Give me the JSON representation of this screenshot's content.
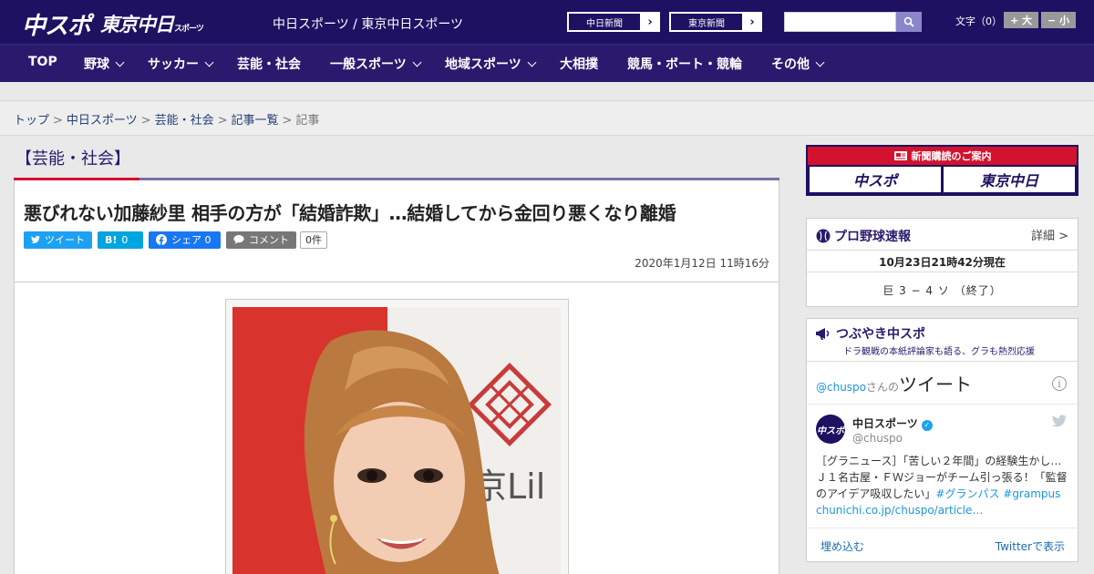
{
  "header": {
    "logo_chuspo": "中スポ",
    "logo_tokyo": "東京中日",
    "logo_tokyo_small": "スポーツ",
    "site_title": "中日スポーツ / 東京中日スポーツ",
    "paper_links": [
      "中日新聞",
      "東京新聞"
    ],
    "search_placeholder": "",
    "fontsize_label": "文字（0）",
    "fontsize_larger": "+ 大",
    "fontsize_smaller": "− 小"
  },
  "nav": {
    "items": [
      {
        "label": "TOP",
        "dropdown": false
      },
      {
        "label": "野球",
        "dropdown": true
      },
      {
        "label": "サッカー",
        "dropdown": true
      },
      {
        "label": "芸能・社会",
        "dropdown": false
      },
      {
        "label": "一般スポーツ",
        "dropdown": true
      },
      {
        "label": "地域スポーツ",
        "dropdown": true
      },
      {
        "label": "大相撲",
        "dropdown": false
      },
      {
        "label": "競馬・ボート・競輪",
        "dropdown": false
      },
      {
        "label": "その他",
        "dropdown": true
      }
    ]
  },
  "breadcrumb": {
    "items": [
      "トップ",
      "中日スポーツ",
      "芸能・社会",
      "記事一覧"
    ],
    "current": "記事"
  },
  "article": {
    "category": "【芸能・社会】",
    "title": "悪びれない加藤紗里 相手の方が「結婚詐欺」…結婚してから金回り悪くなり離婚",
    "share": {
      "tweet": "ツイート",
      "hatena": "B!",
      "hatena_count": "0",
      "facebook": "シェア",
      "facebook_count": "0",
      "comment": "コメント",
      "comment_count": "0件"
    },
    "date": "2020年1月12日 11時16分",
    "photo_text": "京Lil"
  },
  "sidebar": {
    "subscribe_label": "新聞購読のご案内",
    "subscribe_cells": [
      "中スポ",
      "東京中日"
    ],
    "baseball": {
      "title": "プロ野球速報",
      "more": "詳細 >",
      "time": "10月23日21時42分現在",
      "score": "巨 3 − 4 ソ （終了）"
    },
    "tweets": {
      "title": "つぶやき中スポ",
      "subtitle": "ドラ観戦の本紙評論家も語る、グラも熱烈応援",
      "panel_handle": "@chuspo",
      "panel_san": "さんの",
      "panel_word": "ツイート",
      "info": "i",
      "user_name": "中日スポーツ",
      "user_handle": "@chuspo",
      "avatar": "中スポ",
      "body_plain": "［グラニュース］「苦しい２年間」の経験生かし…Ｊ１名古屋・ＦＷジョーがチーム引っ張る！「監督のアイデア吸収したい」",
      "body_tags": "#グランパス #grampus",
      "body_link": "chunichi.co.jp/chuspo/article…",
      "embed": "埋め込む",
      "view_on_twitter": "Twitterで表示"
    }
  },
  "colors": {
    "brand_navy": "#1e1162",
    "nav_bg": "#2a1a6e",
    "accent_red": "#d2122e",
    "twitter_blue": "#1da1f2",
    "facebook_blue": "#1877f2",
    "hatena_blue": "#00a4de"
  }
}
